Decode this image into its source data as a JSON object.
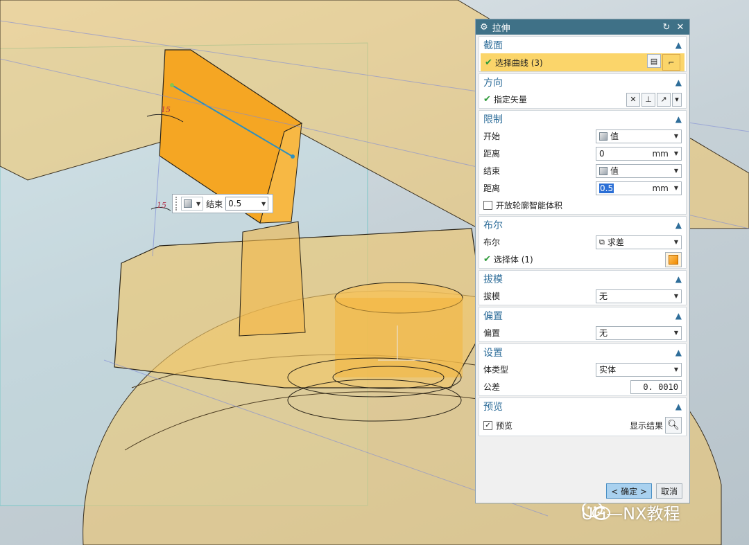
{
  "viewport": {
    "angle_label_1": "15",
    "angle_label_2": "15"
  },
  "handle": {
    "type_icon": "cube-icon",
    "label": "结束",
    "value": "0.5"
  },
  "watermark": {
    "text": "UG—NX教程"
  },
  "dialog": {
    "title": "拉伸",
    "section": {
      "header": "截面",
      "select_curve": "选择曲线 (3)"
    },
    "direction": {
      "header": "方向",
      "specify_vector": "指定矢量"
    },
    "limits": {
      "header": "限制",
      "start_label": "开始",
      "start_option": "值",
      "start_distance_label": "距离",
      "start_distance_value": "0",
      "start_distance_unit": "mm",
      "end_label": "结束",
      "end_option": "值",
      "end_distance_label": "距离",
      "end_distance_value": "0.5",
      "end_distance_unit": "mm",
      "open_profile_label": "开放轮廓智能体积"
    },
    "boolean": {
      "header": "布尔",
      "boolean_label": "布尔",
      "boolean_option": "求差",
      "select_body": "选择体 (1)"
    },
    "draft": {
      "header": "拔模",
      "draft_label": "拔模",
      "draft_option": "无"
    },
    "offset": {
      "header": "偏置",
      "offset_label": "偏置",
      "offset_option": "无"
    },
    "settings": {
      "header": "设置",
      "body_type_label": "体类型",
      "body_type_option": "实体",
      "tolerance_label": "公差",
      "tolerance_value": "0. 0010"
    },
    "preview": {
      "header": "预览",
      "preview_label": "预览",
      "show_result_label": "显示结果"
    },
    "buttons": {
      "ok": "< 确定 >",
      "cancel": "取消"
    }
  },
  "colors": {
    "titlebar": "#3f7187",
    "section_header": "#2f6e9a",
    "selection_highlight": "#fbd56a",
    "model_orange": "#f5a623",
    "model_translucent": "#f4c766"
  }
}
